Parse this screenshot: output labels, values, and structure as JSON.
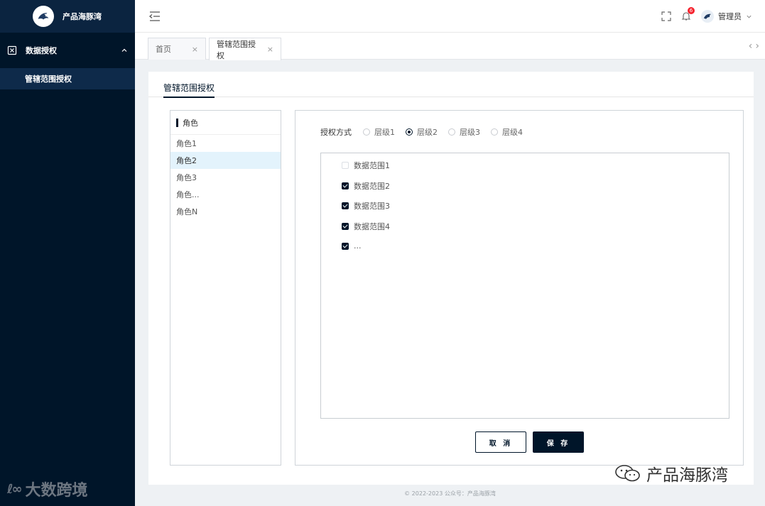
{
  "brand": {
    "name": "产品海豚湾"
  },
  "sidebar": {
    "group": {
      "label": "数据授权",
      "icon": "excel-icon"
    },
    "sub_item": {
      "label": "管辖范围授权"
    }
  },
  "header": {
    "notification_count": "6",
    "user_name": "管理员"
  },
  "tabs": [
    {
      "label": "首页",
      "close": "×"
    },
    {
      "label": "管辖范围授权",
      "close": "×"
    }
  ],
  "card": {
    "title": "管辖范围授权"
  },
  "roles": {
    "title": "角色",
    "items": [
      "角色1",
      "角色2",
      "角色3",
      "角色...",
      "角色N"
    ],
    "selected_index": 1
  },
  "auth": {
    "label": "授权方式",
    "options": [
      "层级1",
      "层级2",
      "层级3",
      "层级4"
    ],
    "selected_index": 1
  },
  "scopes": [
    {
      "label": "数据范围1",
      "checked": false
    },
    {
      "label": "数据范围2",
      "checked": true
    },
    {
      "label": "数据范围3",
      "checked": true
    },
    {
      "label": "数据范围4",
      "checked": true
    },
    {
      "label": "...",
      "checked": true
    }
  ],
  "buttons": {
    "cancel": "取 消",
    "save": "保 存"
  },
  "footer": {
    "text": "© 2022-2023 公众号：产品海豚湾"
  },
  "watermarks": {
    "left": "大数跨境",
    "right": "产品海豚湾"
  },
  "colors": {
    "navy": "#001529",
    "selected_row": "#e3f3fc",
    "badge": "#f5222d"
  }
}
